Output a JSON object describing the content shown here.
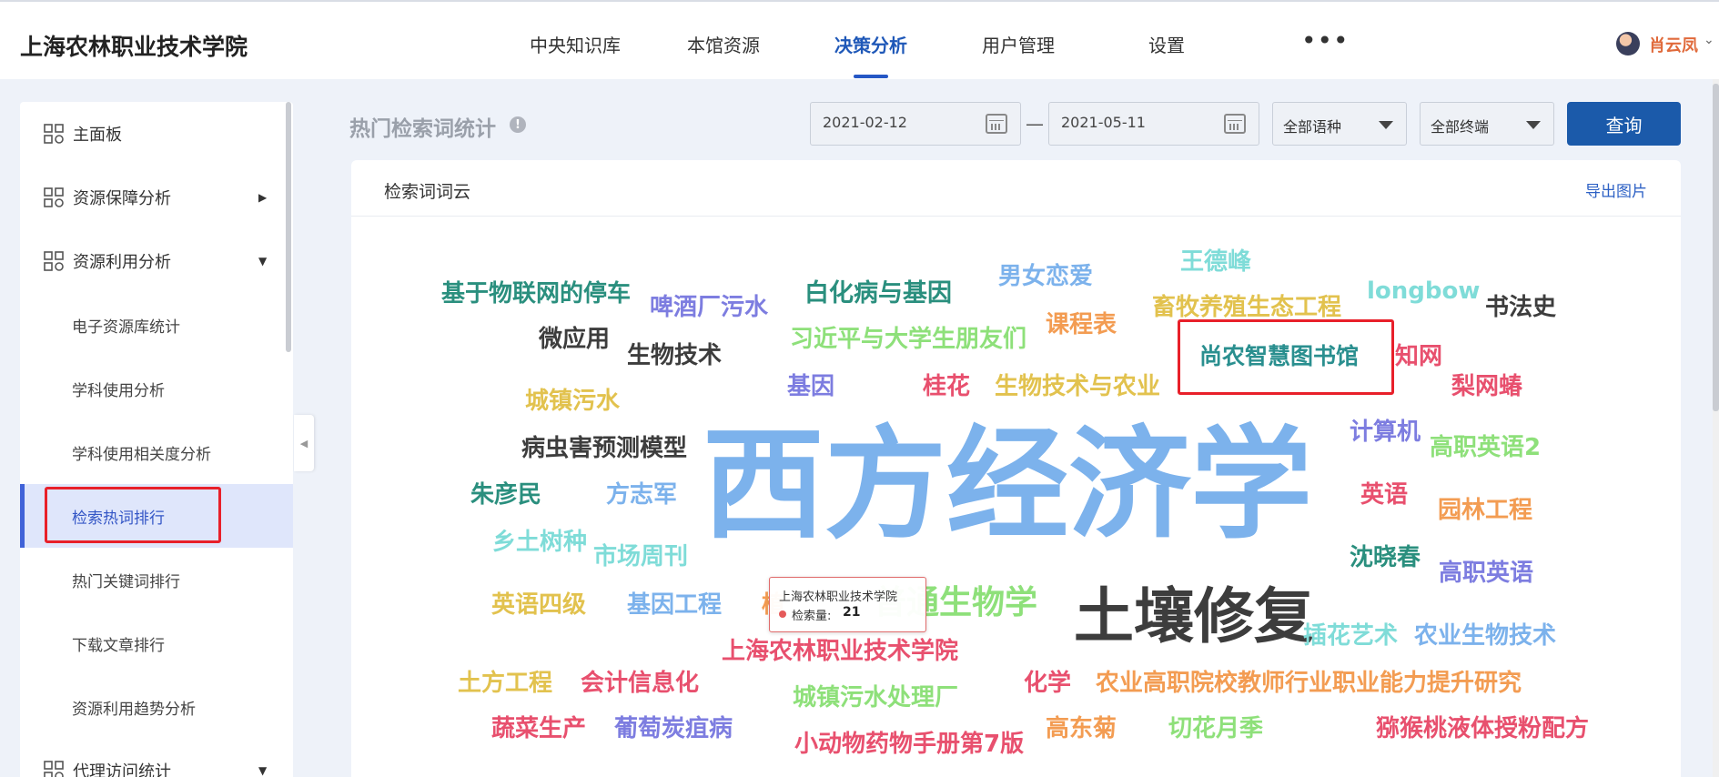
{
  "header": {
    "logo": "上海农林职业技术学院",
    "nav": [
      "中央知识库",
      "本馆资源",
      "决策分析",
      "用户管理",
      "设置"
    ],
    "active_nav": "决策分析",
    "more": "•••",
    "user_name": "肖云凤",
    "user_caret": "⌄"
  },
  "sidebar": {
    "items": [
      {
        "label": "主面板",
        "icon": "dashboard-icon"
      },
      {
        "label": "资源保障分析",
        "icon": "dashboard-icon",
        "arrow": "▶"
      },
      {
        "label": "资源利用分析",
        "icon": "dashboard-icon",
        "arrow": "▼"
      },
      {
        "label": "电子资源库统计"
      },
      {
        "label": "学科使用分析"
      },
      {
        "label": "学科使用相关度分析"
      },
      {
        "label": "检索热词排行"
      },
      {
        "label": "热门关键词排行"
      },
      {
        "label": "下载文章排行"
      },
      {
        "label": "资源利用趋势分析"
      },
      {
        "label": "代理访问统计",
        "icon": "dashboard-icon",
        "arrow": "▼"
      }
    ],
    "selected": "检索热词排行",
    "collapse_glyph": "◀"
  },
  "toolbar": {
    "title": "热门检索词统计",
    "info": "!",
    "start_date": "2021-02-12",
    "end_date": "2021-05-11",
    "separator": "—",
    "language_select": "全部语种",
    "terminal_select": "全部终端",
    "query_label": "查询"
  },
  "card": {
    "title": "检索词词云",
    "export_label": "导出图片"
  },
  "word_cloud": [
    {
      "text": "西方经济学",
      "color": "#7cb2ec"
    },
    {
      "text": "土壤修复",
      "color": "#3d3d3d"
    },
    {
      "text": "尚农智慧图书馆",
      "color": "#2a8f8f"
    },
    {
      "text": "普通生物学",
      "color": "#8ee07a"
    },
    {
      "text": "基于物联网的停车",
      "color": "#2a8f7e"
    },
    {
      "text": "啤酒厂污水",
      "color": "#7d7de0"
    },
    {
      "text": "白化病与基因",
      "color": "#2a8f7e"
    },
    {
      "text": "男女恋爱",
      "color": "#7cb2ec"
    },
    {
      "text": "王德峰",
      "color": "#7fdcd8"
    },
    {
      "text": "畜牧养殖生态工程",
      "color": "#e2c24e"
    },
    {
      "text": "longbow",
      "color": "#7fdcd8"
    },
    {
      "text": "书法史",
      "color": "#3d3d3d"
    },
    {
      "text": "微应用",
      "color": "#3d3d3d"
    },
    {
      "text": "习近平与大学生朋友们",
      "color": "#8ee07a"
    },
    {
      "text": "课程表",
      "color": "#f39c52"
    },
    {
      "text": "知网",
      "color": "#e8506e"
    },
    {
      "text": "生物技术",
      "color": "#3d3d3d"
    },
    {
      "text": "梨网蝽",
      "color": "#e8506e"
    },
    {
      "text": "基因",
      "color": "#7d7de0"
    },
    {
      "text": "桂花",
      "color": "#e8506e"
    },
    {
      "text": "生物技术与农业",
      "color": "#e2c24e"
    },
    {
      "text": "城镇污水",
      "color": "#e2c24e"
    },
    {
      "text": "计算机",
      "color": "#7d7de0"
    },
    {
      "text": "病虫害预测模型",
      "color": "#3d3d3d"
    },
    {
      "text": "高职英语2",
      "color": "#8ee07a"
    },
    {
      "text": "朱彦民",
      "color": "#2a8f7e"
    },
    {
      "text": "方志军",
      "color": "#7cb2ec"
    },
    {
      "text": "英语",
      "color": "#e8506e"
    },
    {
      "text": "园林工程",
      "color": "#f39c52"
    },
    {
      "text": "乡土树种",
      "color": "#7fdcd8"
    },
    {
      "text": "市场周刊",
      "color": "#7fdcd8"
    },
    {
      "text": "沈晓春",
      "color": "#2a8f7e"
    },
    {
      "text": "高职英语",
      "color": "#7d7de0"
    },
    {
      "text": "英语四级",
      "color": "#e2c24e"
    },
    {
      "text": "基因工程",
      "color": "#7cb2ec"
    },
    {
      "text": "植",
      "color": "#f39c52"
    },
    {
      "text": "插花艺术",
      "color": "#7fdcd8"
    },
    {
      "text": "农业生物技术",
      "color": "#7cb2ec"
    },
    {
      "text": "上海农林职业技术学院",
      "color": "#e8506e"
    },
    {
      "text": "土方工程",
      "color": "#e2c24e"
    },
    {
      "text": "会计信息化",
      "color": "#e8506e"
    },
    {
      "text": "城镇污水处理厂",
      "color": "#8ee07a"
    },
    {
      "text": "化学",
      "color": "#e8506e"
    },
    {
      "text": "农业高职院校教师行业职业能力提升研究",
      "color": "#f39c52"
    },
    {
      "text": "蔬菜生产",
      "color": "#e8506e"
    },
    {
      "text": "葡萄炭疽病",
      "color": "#7d7de0"
    },
    {
      "text": "高东菊",
      "color": "#f39c52"
    },
    {
      "text": "切花月季",
      "color": "#8ee07a"
    },
    {
      "text": "猕猴桃液体授粉配方",
      "color": "#e8506e"
    },
    {
      "text": "小动物药物手册第7版",
      "color": "#e8506e"
    }
  ],
  "tooltip": {
    "title": "上海农林职业技术学院",
    "metric_label": "检索量:",
    "metric_value": "21"
  }
}
